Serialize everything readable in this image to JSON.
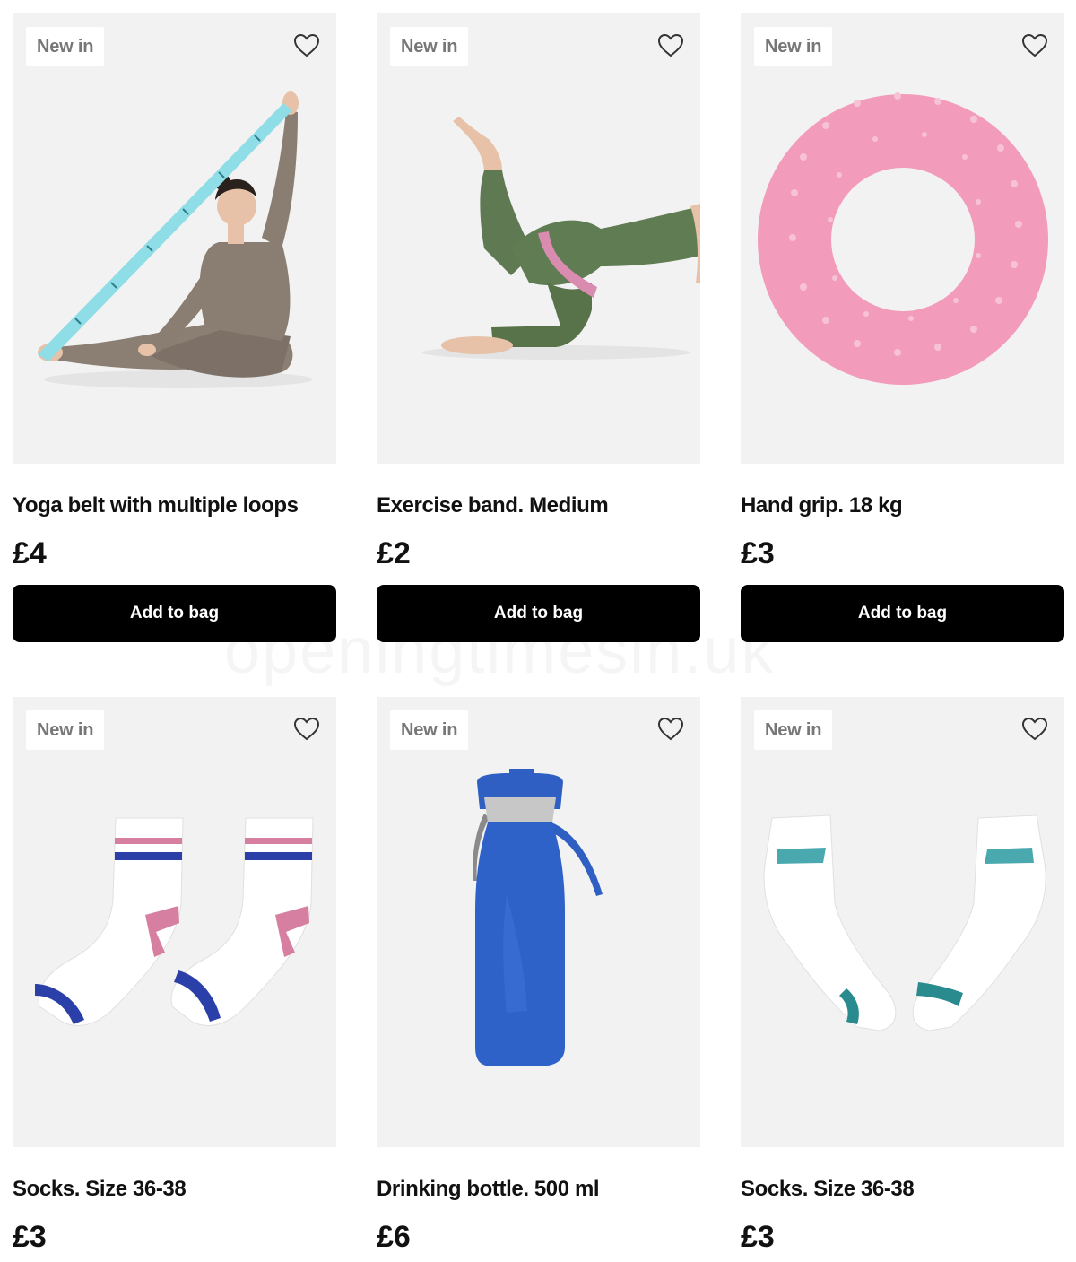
{
  "watermark": "openingtimesin.uk",
  "products": [
    {
      "badge": "New in",
      "title": "Yoga belt with multiple loops",
      "price": "£4",
      "button": "Add to bag",
      "image": "yoga-belt"
    },
    {
      "badge": "New in",
      "title": "Exercise band. Medium",
      "price": "£2",
      "button": "Add to bag",
      "image": "exercise-band"
    },
    {
      "badge": "New in",
      "title": "Hand grip. 18 kg",
      "price": "£3",
      "button": "Add to bag",
      "image": "hand-grip"
    },
    {
      "badge": "New in",
      "title": "Socks. Size 36-38",
      "price": "£3",
      "image": "striped-socks"
    },
    {
      "badge": "New in",
      "title": "Drinking bottle. 500 ml",
      "price": "£6",
      "image": "drinking-bottle"
    },
    {
      "badge": "New in",
      "title": "Socks. Size 36-38",
      "price": "£3",
      "image": "funday-socks"
    }
  ],
  "colors": {
    "button_bg": "#000000",
    "button_text": "#ffffff",
    "image_bg": "#f2f2f2",
    "badge_text": "#777777"
  },
  "icons": {
    "wishlist": "heart-icon"
  }
}
